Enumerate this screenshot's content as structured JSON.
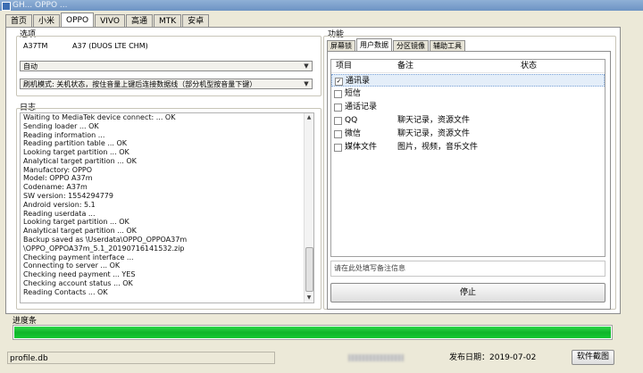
{
  "window": {
    "title": "GH... OPPO ..."
  },
  "tabs": [
    "首页",
    "小米",
    "OPPO",
    "VIVO",
    "高通",
    "MTK",
    "安卓"
  ],
  "active_tab": "OPPO",
  "options": {
    "label": "选项",
    "model_code": "A37TM",
    "model_name": "A37 (DUOS LTE CHM)",
    "mode": "自动",
    "flash_hint": "刷机模式: 关机状态，按住音量上键后连接数据线（部分机型按音量下键）"
  },
  "log": {
    "label": "日志",
    "lines": [
      "Waiting to MediaTek device connect: ... OK",
      "Sending loader ... OK",
      "Reading information ...",
      "Reading partition table ... OK",
      "Looking target partition ... OK",
      "Analytical target partition ... OK",
      "Manufactory: OPPO",
      "Model: OPPO A37m",
      "Codename: A37m",
      "SW version: 1554294779",
      "Android version: 5.1",
      "Reading userdata ...",
      "Looking target partition ... OK",
      "Analytical target partition ... OK",
      "Backup saved as \\Userdata\\OPPO_OPPOA37m",
      "\\OPPO_OPPOA37m_5.1_20190716141532.zip",
      "Checking payment interface ...",
      "Connecting to server ... OK",
      "Checking need payment ... YES",
      "Checking account status ... OK",
      "Reading Contacts ... OK"
    ]
  },
  "functions": {
    "label": "功能",
    "tabs": [
      "屏幕锁",
      "用户数据",
      "分区镜像",
      "辅助工具"
    ],
    "active_tab": "用户数据",
    "headers": {
      "item": "项目",
      "note": "备注",
      "status": "状态"
    },
    "rows": [
      {
        "item": "通讯录",
        "note": "",
        "checked": "✓"
      },
      {
        "item": "短信",
        "note": "",
        "checked": ""
      },
      {
        "item": "通话记录",
        "note": "",
        "checked": ""
      },
      {
        "item": "QQ",
        "note": "聊天记录，资源文件",
        "checked": ""
      },
      {
        "item": "微信",
        "note": "聊天记录，资源文件",
        "checked": ""
      },
      {
        "item": "媒体文件",
        "note": "图片，视频，音乐文件",
        "checked": ""
      }
    ],
    "note_placeholder": "请在此处填写备注信息",
    "stop_button": "停止"
  },
  "progress": {
    "label": "进度条",
    "percent": 100,
    "color": "#1ec83a"
  },
  "statusbar": {
    "file": "profile.db",
    "release_date": "发布日期：2019-07-02",
    "screenshot_button": "软件截图"
  }
}
